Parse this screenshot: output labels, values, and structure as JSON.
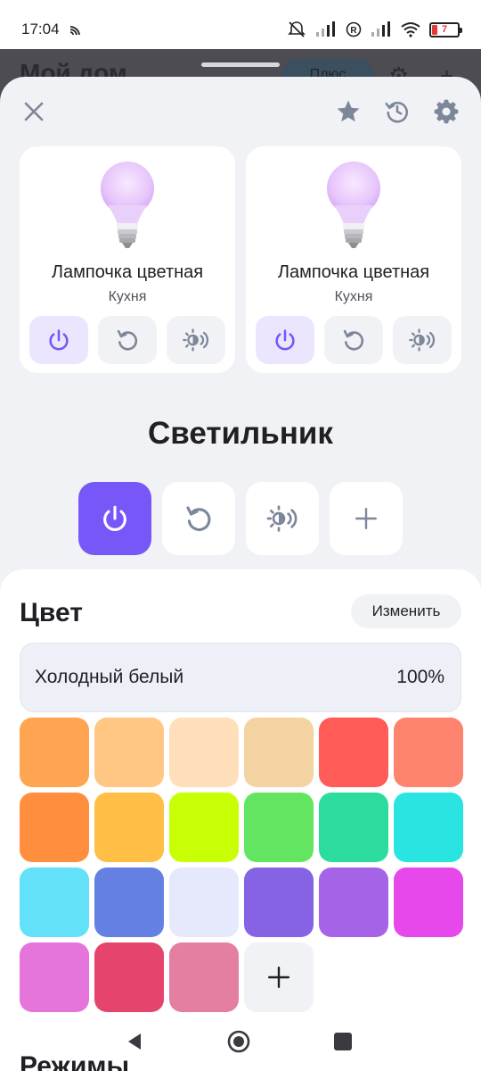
{
  "status_bar": {
    "time": "17:04",
    "battery": "7"
  },
  "background": {
    "title": "Мой дом",
    "plus_label": "Плюс"
  },
  "cards": [
    {
      "name": "Лампочка цветная",
      "room": "Кухня"
    },
    {
      "name": "Лампочка цветная",
      "room": "Кухня"
    }
  ],
  "device": {
    "title": "Светильник"
  },
  "color_section": {
    "title": "Цвет",
    "change_label": "Изменить",
    "current_name": "Холодный белый",
    "current_brightness": "100%",
    "swatches": [
      "#ffa552",
      "#ffc783",
      "#ffdfb9",
      "#f4d3a2",
      "#ff5b57",
      "#fe846f",
      "#ff8f3f",
      "#ffbe45",
      "#c8ff04",
      "#63e561",
      "#2bdc9e",
      "#2ae4e2",
      "#63e1f9",
      "#6480e3",
      "#e5e9fb",
      "#8662e5",
      "#a563e8",
      "#e648eb",
      "#e575db",
      "#e5456d",
      "#e57fa1"
    ]
  },
  "modes_section": {
    "title": "Режимы"
  },
  "icons": {
    "close": "close-icon",
    "star": "star-icon",
    "history": "history-icon",
    "settings": "gear-icon",
    "power": "power-icon",
    "reset": "reset-icon",
    "brightness": "brightness-icon",
    "plus": "plus-icon"
  },
  "colors": {
    "accent": "#7857f8",
    "accent_light": "#ebe6fd",
    "icon_gray": "#7c8799"
  }
}
